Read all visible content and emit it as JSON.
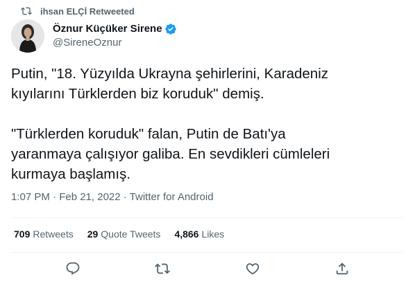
{
  "retweet": {
    "label": "ihsan ELÇİ Retweeted"
  },
  "author": {
    "display_name": "Öznur Küçüker Sirene",
    "handle": "@SireneOznur"
  },
  "tweet": {
    "text": "Putin, \"18. Yüzyılda Ukrayna şehirlerini, Karadeniz\nkıyılarını Türklerden biz koruduk\" demiş.\n\n\"Türklerden koruduk\" falan, Putin de Batı'ya\nyaranmaya çalışıyor galiba. En sevdikleri cümleleri\nkurmaya başlamış.",
    "timestamp": "1:07 PM · Feb 21, 2022 · Twitter for Android"
  },
  "stats": {
    "retweets": {
      "count": "709",
      "label": "Retweets"
    },
    "quotes": {
      "count": "29",
      "label": "Quote Tweets"
    },
    "likes": {
      "count": "4,866",
      "label": "Likes"
    }
  },
  "icons": {
    "retweet_indicator": "retweet-icon",
    "verified": "verified-badge-icon",
    "reply": "reply-icon",
    "retweet": "retweet-icon",
    "like": "heart-icon",
    "share": "share-icon"
  },
  "colors": {
    "verified": "#1d9bf0",
    "secondary_text": "#536471"
  }
}
